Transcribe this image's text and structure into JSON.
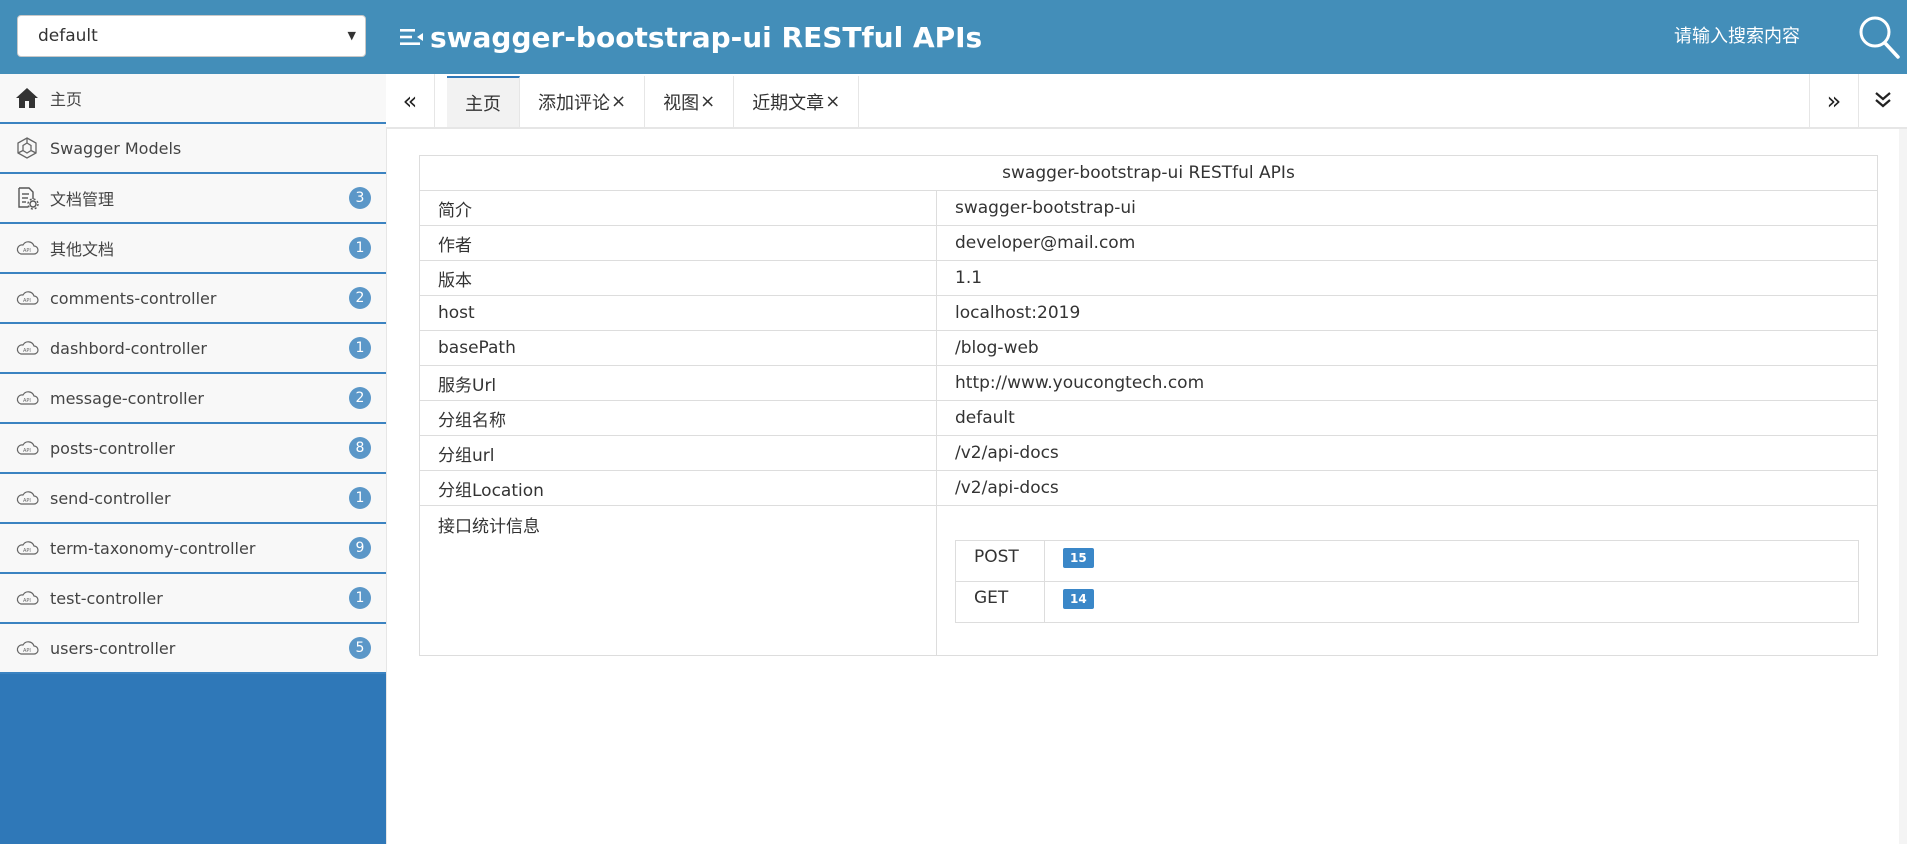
{
  "header": {
    "group_select": "default",
    "title": "swagger-bootstrap-ui RESTful APIs",
    "search_placeholder": "请输入搜索内容",
    "icons": {
      "menu": "menu-toggle-icon",
      "search": "search-icon"
    }
  },
  "sidebar": {
    "items": [
      {
        "label": "主页",
        "icon": "home-icon",
        "badge": ""
      },
      {
        "label": "Swagger Models",
        "icon": "models-icon",
        "badge": ""
      },
      {
        "label": "文档管理",
        "icon": "doc-settings-icon",
        "badge": "3"
      },
      {
        "label": "其他文档",
        "icon": "api-cloud-icon",
        "badge": "1"
      },
      {
        "label": "comments-controller",
        "icon": "api-cloud-icon",
        "badge": "2"
      },
      {
        "label": "dashbord-controller",
        "icon": "api-cloud-icon",
        "badge": "1"
      },
      {
        "label": "message-controller",
        "icon": "api-cloud-icon",
        "badge": "2"
      },
      {
        "label": "posts-controller",
        "icon": "api-cloud-icon",
        "badge": "8"
      },
      {
        "label": "send-controller",
        "icon": "api-cloud-icon",
        "badge": "1"
      },
      {
        "label": "term-taxonomy-controller",
        "icon": "api-cloud-icon",
        "badge": "9"
      },
      {
        "label": "test-controller",
        "icon": "api-cloud-icon",
        "badge": "1"
      },
      {
        "label": "users-controller",
        "icon": "api-cloud-icon",
        "badge": "5"
      }
    ]
  },
  "tabs": {
    "prev": "«",
    "next": "»",
    "more": "⌄",
    "items": [
      {
        "label": "主页",
        "closable": false,
        "active": true
      },
      {
        "label": "添加评论",
        "closable": true,
        "active": false
      },
      {
        "label": "视图",
        "closable": true,
        "active": false
      },
      {
        "label": "近期文章",
        "closable": true,
        "active": false
      }
    ],
    "close_glyph": "×"
  },
  "info": {
    "title": "swagger-bootstrap-ui RESTful APIs",
    "rows": [
      {
        "key": "简介",
        "value": "swagger-bootstrap-ui"
      },
      {
        "key": "作者",
        "value": "developer@mail.com"
      },
      {
        "key": "版本",
        "value": "1.1"
      },
      {
        "key": "host",
        "value": "localhost:2019"
      },
      {
        "key": "basePath",
        "value": "/blog-web"
      },
      {
        "key": "服务Url",
        "value": "http://www.youcongtech.com"
      },
      {
        "key": "分组名称",
        "value": "default"
      },
      {
        "key": "分组url",
        "value": "/v2/api-docs"
      },
      {
        "key": "分组Location",
        "value": "/v2/api-docs"
      }
    ],
    "stats_label": "接口统计信息",
    "stats": [
      {
        "method": "POST",
        "count": "15"
      },
      {
        "method": "GET",
        "count": "14"
      }
    ]
  },
  "colors": {
    "header": "#438eb9",
    "sidebar": "#2f78b8",
    "badge": "#5b97c8",
    "count_badge": "#3a87c8"
  }
}
